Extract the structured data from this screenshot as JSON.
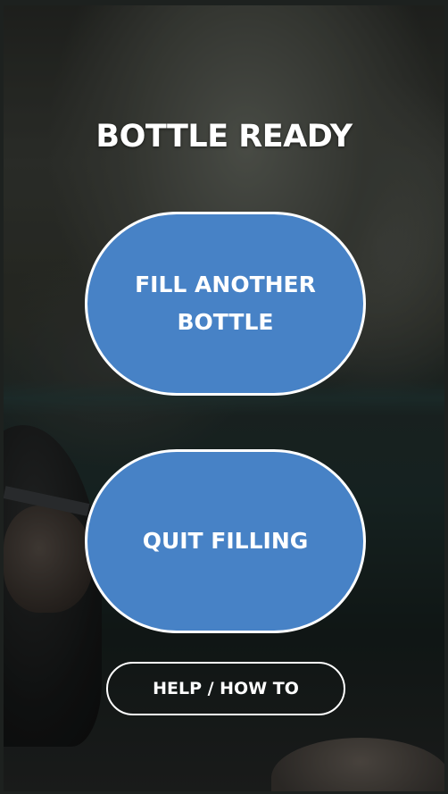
{
  "screen": {
    "title": "BOTTLE READY"
  },
  "actions": {
    "fill_another_label": "FILL ANOTHER BOTTLE",
    "quit_filling_label": "QUIT FILLING",
    "help_label": "HELP / HOW TO"
  },
  "colors": {
    "button_fill": "#4782c6",
    "button_border": "#ffffff",
    "text": "#ffffff"
  }
}
